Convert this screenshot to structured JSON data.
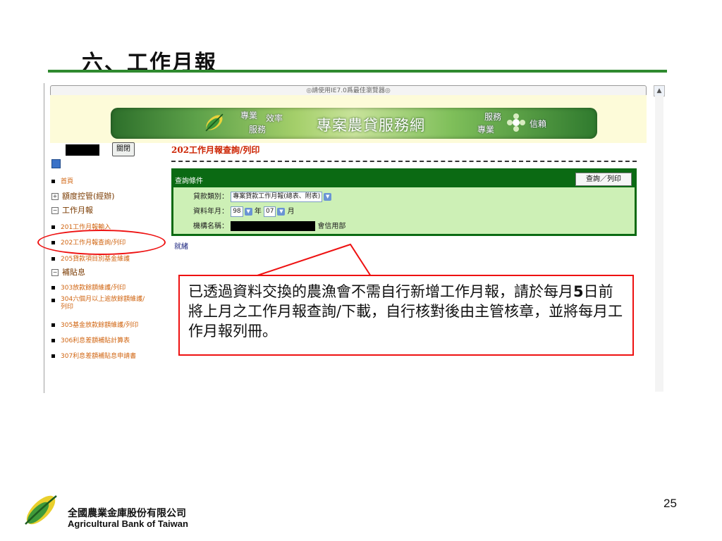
{
  "slide": {
    "title": "六、工作月報",
    "page_number": "25"
  },
  "browser": {
    "address_text": "◎請使用IE7.0爲最佳瀏覽器◎",
    "banner_title": "專案農貸服務網",
    "slogans": [
      "專業",
      "效率",
      "服務",
      "服務",
      "專業",
      "信賴"
    ]
  },
  "nav": {
    "close_button": "關閉",
    "items": [
      {
        "type": "item",
        "label": "首頁"
      },
      {
        "type": "section",
        "label": "額度控管(經辦)",
        "expander": "+"
      },
      {
        "type": "section",
        "label": "工作月報",
        "expander": "−"
      },
      {
        "type": "item",
        "label": "201工作月報輸入"
      },
      {
        "type": "item",
        "label": "202工作月報查詢/列印"
      },
      {
        "type": "item",
        "label": "205貸款項目別基金維護"
      },
      {
        "type": "section",
        "label": "補貼息",
        "expander": "−"
      },
      {
        "type": "item",
        "label": "303放款餘額維護/列印"
      },
      {
        "type": "item",
        "label": "304六個月以上逾放餘額維護/列印"
      },
      {
        "type": "item",
        "label": "305基金放款餘額維護/列印"
      },
      {
        "type": "item",
        "label": "306利息差額補貼計算表"
      },
      {
        "type": "item",
        "label": "307利息差額補貼息申請書"
      }
    ]
  },
  "main": {
    "heading": "202工作月報查詢/列印",
    "query_label": "查詢條件",
    "query_button": "查詢／列印",
    "loan_type_label": "貸款類別：",
    "loan_type_value": "專案貸款工作月報(總表、附表)",
    "period_label": "資料年月：",
    "year_value": "98",
    "year_unit": "年",
    "month_value": "07",
    "month_unit": "月",
    "org_label": "機構名稱：",
    "org_suffix": "會信用部",
    "status": "就緒"
  },
  "callout": {
    "part1": "已透過資料交換的農漁會不需自行新增工作月報，請於每月",
    "bold": "5",
    "part2": "日前將上月之工作月報查詢/下載，自行核對後由主管核章，並將每月工作月報列冊。"
  },
  "footer": {
    "bank_name_zh": "全國農業金庫股份有限公司",
    "bank_name_en": "Agricultural Bank of Taiwan"
  },
  "colors": {
    "accent_green": "#2f8a2f",
    "highlight_red": "#e11111",
    "nav_orange": "#d06410"
  }
}
